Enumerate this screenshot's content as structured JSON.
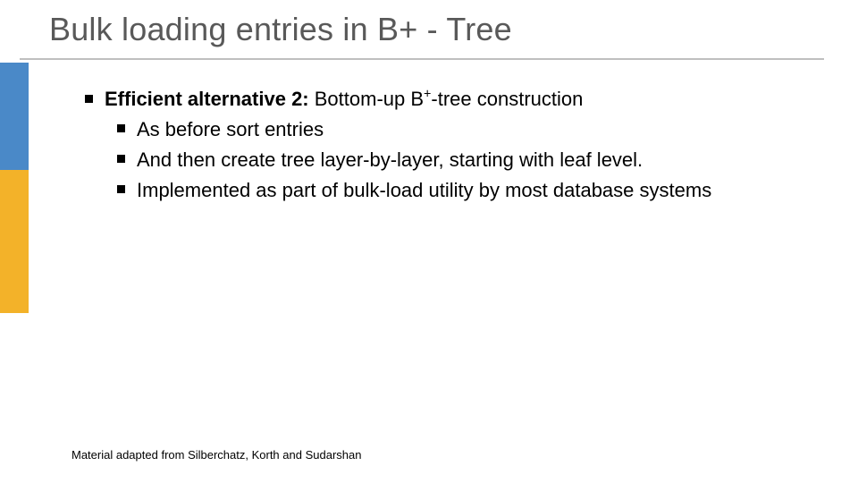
{
  "title": "Bulk loading entries in B+ - Tree",
  "bullet1": {
    "lead": "Efficient alternative 2:",
    "rest_before_sup": " Bottom-up B",
    "sup": "+",
    "rest_after_sup": "-tree construction"
  },
  "sub1": "As before sort entries",
  "sub2": "And then create tree layer-by-layer, starting with leaf level.",
  "sub3": "Implemented as part of bulk-load utility by most database systems",
  "footer": "Material adapted from Silberchatz, Korth and Sudarshan"
}
